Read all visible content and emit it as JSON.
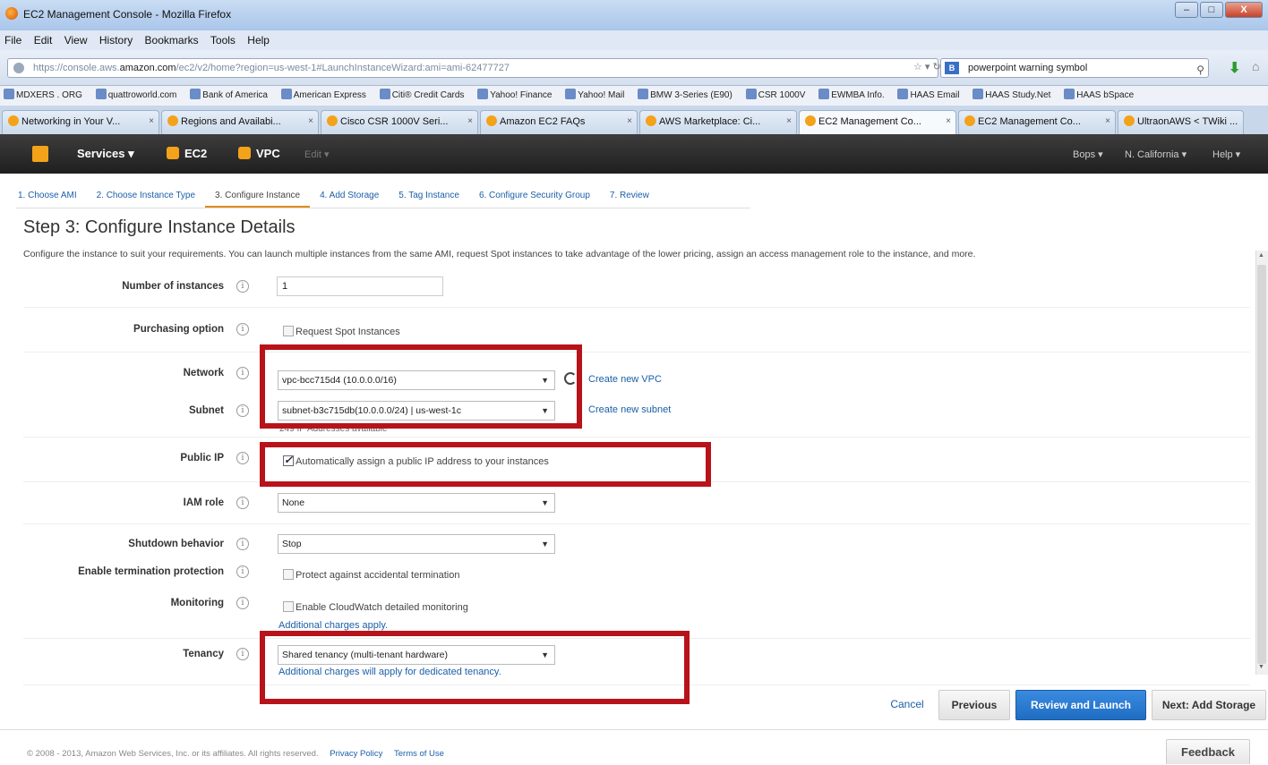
{
  "window": {
    "title": "EC2 Management Console - Mozilla Firefox",
    "controls": [
      "–",
      "□",
      "X"
    ]
  },
  "menu": [
    "File",
    "Edit",
    "View",
    "History",
    "Bookmarks",
    "Tools",
    "Help"
  ],
  "address_bar": {
    "url_prefix": "https://console.aws.",
    "url_domain": "amazon.com",
    "url_rest": "/ec2/v2/home?region=us-west-1#LaunchInstanceWizard:ami=ami-62477727"
  },
  "search_bar": {
    "engine": "B",
    "value": "powerpoint warning symbol"
  },
  "bookmarks": [
    "MDXERS . ORG",
    "quattroworld.com",
    "Bank of America",
    "American Express",
    "Citi® Credit Cards",
    "Yahoo! Finance",
    "Yahoo! Mail",
    "BMW 3-Series (E90)",
    "CSR 1000V",
    "EWMBA Info.",
    "HAAS Email",
    "HAAS Study.Net",
    "HAAS bSpace"
  ],
  "tabs": [
    {
      "label": "Networking in Your V...",
      "active": false
    },
    {
      "label": "Regions and Availabi...",
      "active": false
    },
    {
      "label": "Cisco CSR 1000V Seri...",
      "active": false
    },
    {
      "label": "Amazon EC2 FAQs",
      "active": false
    },
    {
      "label": "AWS Marketplace: Ci...",
      "active": false
    },
    {
      "label": "EC2 Management Co...",
      "active": true
    },
    {
      "label": "EC2 Management Co...",
      "active": false
    },
    {
      "label": "UltraonAWS < TWiki ...",
      "active": false
    }
  ],
  "aws_nav": {
    "services": "Services",
    "ec2": "EC2",
    "vpc": "VPC",
    "edit": "Edit",
    "user": "Bops",
    "region": "N. California",
    "help": "Help"
  },
  "wizard_steps": [
    {
      "label": "1. Choose AMI",
      "active": false
    },
    {
      "label": "2. Choose Instance Type",
      "active": false
    },
    {
      "label": "3. Configure Instance",
      "active": true
    },
    {
      "label": "4. Add Storage",
      "active": false
    },
    {
      "label": "5. Tag Instance",
      "active": false
    },
    {
      "label": "6. Configure Security Group",
      "active": false
    },
    {
      "label": "7. Review",
      "active": false
    }
  ],
  "page": {
    "title": "Step 3: Configure Instance Details",
    "description": "Configure the instance to suit your requirements. You can launch multiple instances from the same AMI, request Spot instances to take advantage of the lower pricing, assign an access management role to the instance, and more."
  },
  "form": {
    "instances": {
      "label": "Number of instances",
      "value": "1"
    },
    "purchasing": {
      "label": "Purchasing option",
      "checkbox": "Request Spot Instances",
      "checked": false
    },
    "network": {
      "label": "Network",
      "value": "vpc-bcc715d4 (10.0.0.0/16)",
      "link": "Create new VPC"
    },
    "subnet": {
      "label": "Subnet",
      "value": "subnet-b3c715db(10.0.0.0/24) | us-west-1c",
      "link": "Create new subnet",
      "hint": "249 IP Addresses available"
    },
    "public_ip": {
      "label": "Public IP",
      "checkbox": "Automatically assign a public IP address to your instances",
      "checked": true
    },
    "iam": {
      "label": "IAM role",
      "value": "None"
    },
    "shutdown": {
      "label": "Shutdown behavior",
      "value": "Stop"
    },
    "termination": {
      "label": "Enable termination protection",
      "checkbox": "Protect against accidental termination",
      "checked": false
    },
    "monitoring": {
      "label": "Monitoring",
      "checkbox": "Enable CloudWatch detailed monitoring",
      "checked": false,
      "link": "Additional charges apply."
    },
    "tenancy": {
      "label": "Tenancy",
      "value": "Shared tenancy (multi-tenant hardware)",
      "link": "Additional charges will apply for dedicated tenancy."
    }
  },
  "info_glyph": "i",
  "buttons": {
    "cancel": "Cancel",
    "previous": "Previous",
    "review": "Review and Launch",
    "next": "Next: Add Storage"
  },
  "footer": {
    "copyright": "© 2008 - 2013, Amazon Web Services, Inc. or its affiliates. All rights reserved.",
    "privacy": "Privacy Policy",
    "terms": "Terms of Use",
    "feedback": "Feedback"
  },
  "annotation_color": "#b8131a"
}
